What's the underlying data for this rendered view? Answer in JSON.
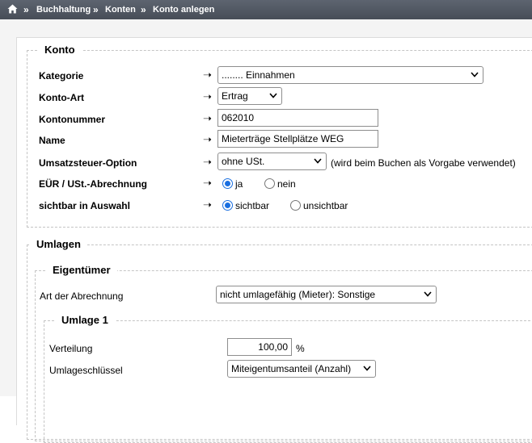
{
  "breadcrumb": {
    "separator": "»",
    "items": [
      "Buchhaltung",
      "Konten",
      "Konto anlegen"
    ]
  },
  "konto": {
    "legend": "Konto",
    "kategorie": {
      "label": "Kategorie",
      "value": "........ Einnahmen"
    },
    "konto_art": {
      "label": "Konto-Art",
      "value": "Ertrag"
    },
    "kontonummer": {
      "label": "Kontonummer",
      "value": "062010"
    },
    "name": {
      "label": "Name",
      "value": "Mieterträge Stellplätze WEG"
    },
    "umsatzsteuer": {
      "label": "Umsatzsteuer-Option",
      "value": "ohne USt.",
      "hint": "(wird beim Buchen als Vorgabe verwendet)"
    },
    "eur": {
      "label": "EÜR / USt.-Abrechnung",
      "option_yes": "ja",
      "option_no": "nein",
      "selected": "ja"
    },
    "sichtbar": {
      "label": "sichtbar in Auswahl",
      "option_visible": "sichtbar",
      "option_invisible": "unsichtbar",
      "selected": "sichtbar"
    }
  },
  "umlagen": {
    "legend": "Umlagen",
    "eigentuemer": {
      "legend": "Eigentümer",
      "art_label": "Art der Abrechnung",
      "art_value": "nicht umlagefähig (Mieter): Sonstige",
      "umlage1": {
        "legend": "Umlage 1",
        "verteilung_label": "Verteilung",
        "verteilung_value": "100,00",
        "verteilung_unit": "%",
        "schluessel_label": "Umlageschlüssel",
        "schluessel_value": "Miteigentumsanteil (Anzahl)"
      }
    }
  },
  "colors": {
    "topbar": "#4f5661",
    "radio_selected": "#1a6fe0",
    "canvas": "#f4f4f4"
  }
}
